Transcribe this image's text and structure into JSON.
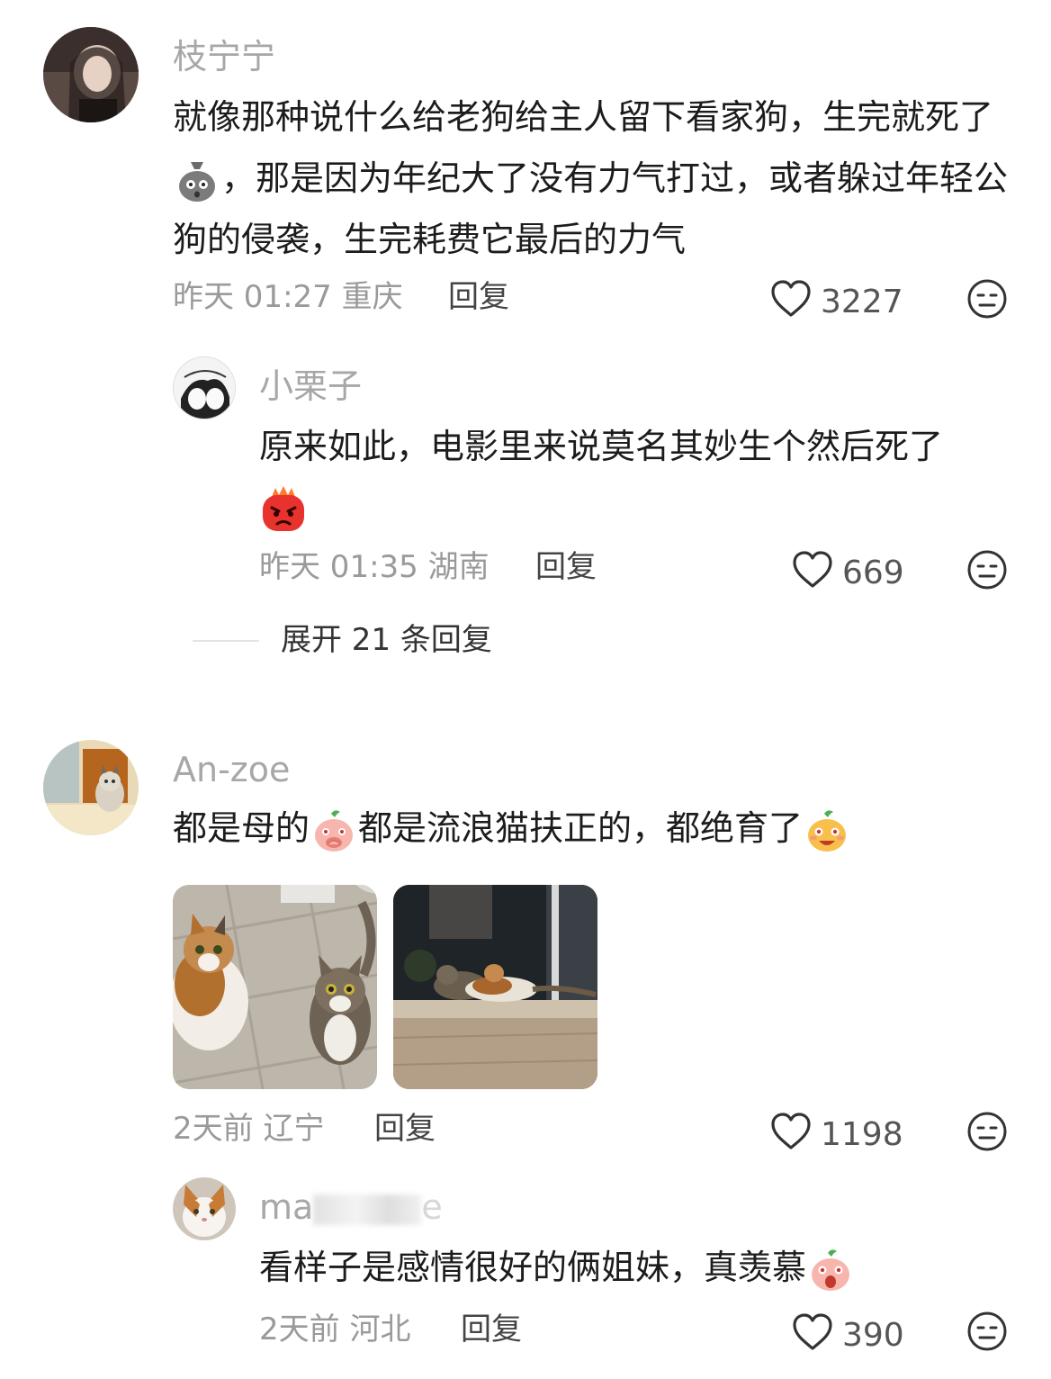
{
  "comments": [
    {
      "username": "枝宁宁",
      "text_parts": [
        "就像那种说什么给老狗给主人留下看家狗，生完就死了",
        "，那是因为年纪大了没有力气打过，或者躲过年轻公狗的侵袭，生完耗费它最后的力气"
      ],
      "emoji": "shocked-bag-emoji",
      "time": "昨天 01:27",
      "location": "重庆",
      "reply_label": "回复",
      "likes": "3227",
      "replies": [
        {
          "username": "小栗子",
          "text": "原来如此，电影里来说莫名其妙生个然后死了",
          "emoji": "angry-face-emoji",
          "time": "昨天 01:35",
          "location": "湖南",
          "reply_label": "回复",
          "likes": "669"
        }
      ],
      "expand_label": "展开 21 条回复"
    },
    {
      "username": "An-zoe",
      "text_parts": [
        "都是母的",
        "都是流浪猫扶正的，都绝育了"
      ],
      "emojis": [
        "covering-mouth-emoji",
        "happy-peach-emoji"
      ],
      "images": [
        "two-cats-on-tile-floor",
        "two-cats-on-windowsill"
      ],
      "time": "2天前",
      "location": "辽宁",
      "reply_label": "回复",
      "likes": "1198",
      "replies": [
        {
          "username": "ma",
          "username_blurred_suffix": "e",
          "text": "看样子是感情很好的俩姐妹，真羡慕",
          "emoji": "screaming-peach-emoji",
          "time": "2天前",
          "location": "河北",
          "reply_label": "回复",
          "likes": "390"
        }
      ]
    }
  ],
  "colors": {
    "username": "#a7a7a7",
    "meta": "#9a9a9a",
    "text": "#1c1c1c"
  }
}
